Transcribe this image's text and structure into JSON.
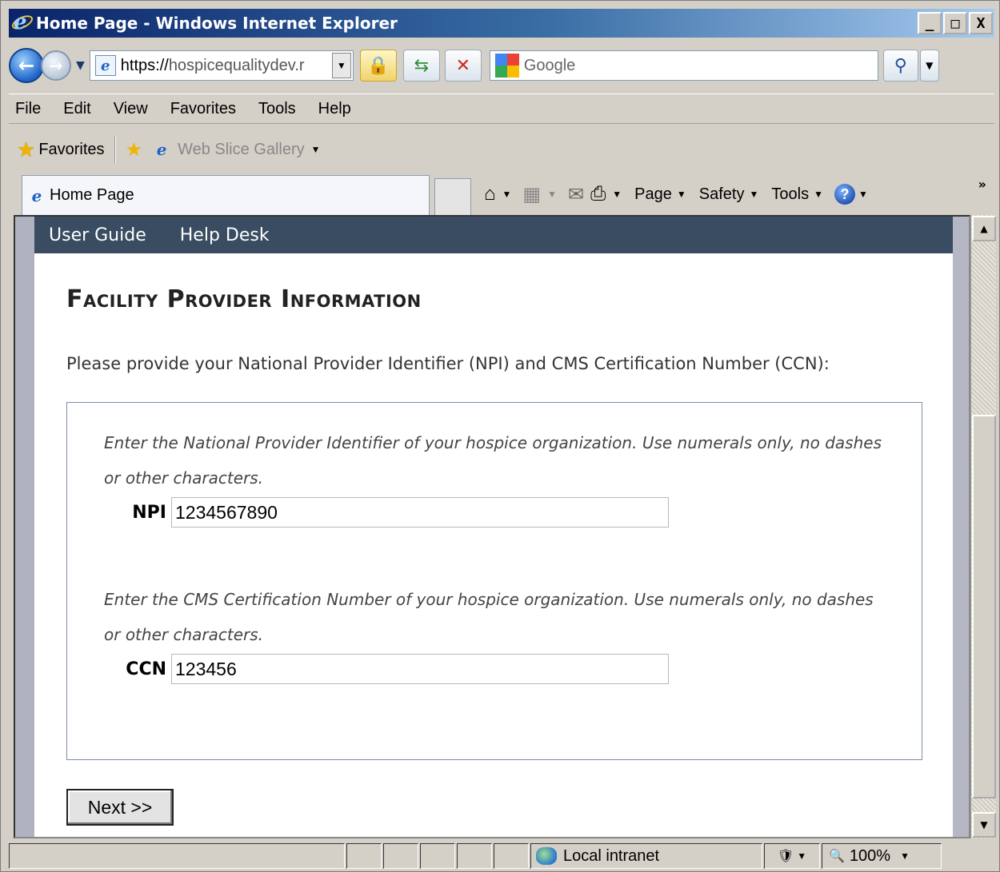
{
  "window": {
    "title": "Home Page - Windows Internet Explorer",
    "min": "_",
    "max": "□",
    "close": "X"
  },
  "nav": {
    "url_proto": "https://",
    "url_host": "hospicequalitydev.r",
    "search_placeholder": "Google"
  },
  "menu": [
    "File",
    "Edit",
    "View",
    "Favorites",
    "Tools",
    "Help"
  ],
  "favorites": {
    "label": "Favorites",
    "web_slice": "Web Slice Gallery"
  },
  "tab": {
    "title": "Home Page"
  },
  "command_bar": {
    "page": "Page",
    "safety": "Safety",
    "tools": "Tools"
  },
  "page": {
    "nav_links": [
      "User Guide",
      "Help Desk"
    ],
    "heading": "Facility Provider Information",
    "intro": "Please provide your National Provider Identifier (NPI) and CMS Certification Number (CCN):",
    "npi_instruction": "Enter the National Provider Identifier of your hospice organization. Use numerals only, no dashes or other characters.",
    "npi_label": "NPI",
    "npi_value": "1234567890",
    "ccn_instruction": "Enter the CMS Certification Number of your hospice organization. Use numerals only, no dashes or other characters.",
    "ccn_label": "CCN",
    "ccn_value": "123456",
    "next_button": "Next >>"
  },
  "status": {
    "zone": "Local intranet",
    "zoom": "100%"
  },
  "colors": {
    "site_nav_bg": "#394c61",
    "title_bar_start": "#0a246a",
    "form_border": "#7c8daa"
  }
}
